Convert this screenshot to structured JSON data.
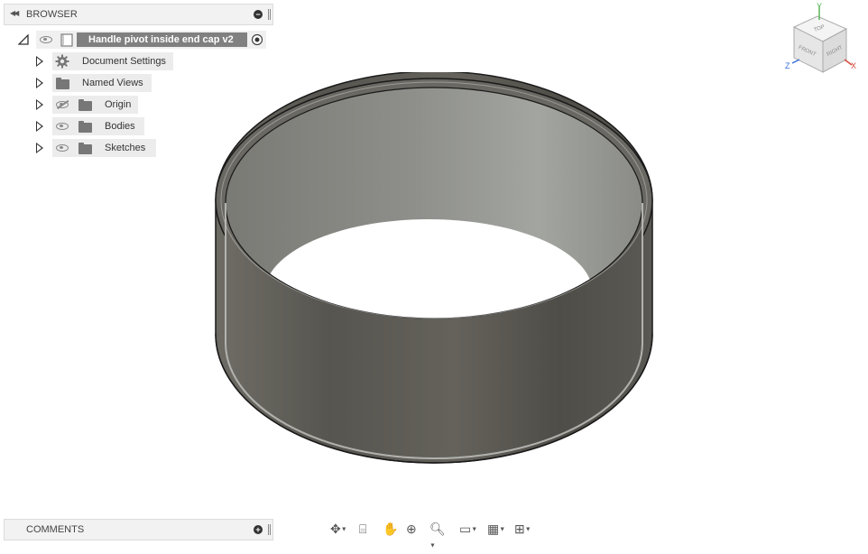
{
  "browser": {
    "collapse_icon": "double-chevron-left-icon",
    "title": "BROWSER",
    "root": {
      "label": "Handle pivot inside end cap v2"
    },
    "items": [
      {
        "label": "Document Settings",
        "icon": "gear-icon",
        "visible": null
      },
      {
        "label": "Named Views",
        "icon": "folder-icon",
        "visible": null
      },
      {
        "label": "Origin",
        "icon": "folder-icon",
        "visible": false
      },
      {
        "label": "Bodies",
        "icon": "folder-icon",
        "visible": true
      },
      {
        "label": "Sketches",
        "icon": "folder-icon",
        "visible": true
      }
    ]
  },
  "comments": {
    "title": "COMMENTS"
  },
  "viewcube": {
    "top": "TOP",
    "front": "FRONT",
    "right": "RIGHT",
    "x": "X",
    "y": "Y",
    "z": "Z"
  },
  "navbar": {
    "tools": [
      "orbit-icon",
      "look-at-icon",
      "pan-icon",
      "zoom-icon",
      "zoom-window-icon",
      "display-settings-icon",
      "grid-icon",
      "viewports-icon"
    ]
  },
  "colors": {
    "model_body": "#5f5d56",
    "model_inner": "#9a9c97",
    "panel_bg": "#f2f2f2",
    "root_highlight": "#808080"
  }
}
